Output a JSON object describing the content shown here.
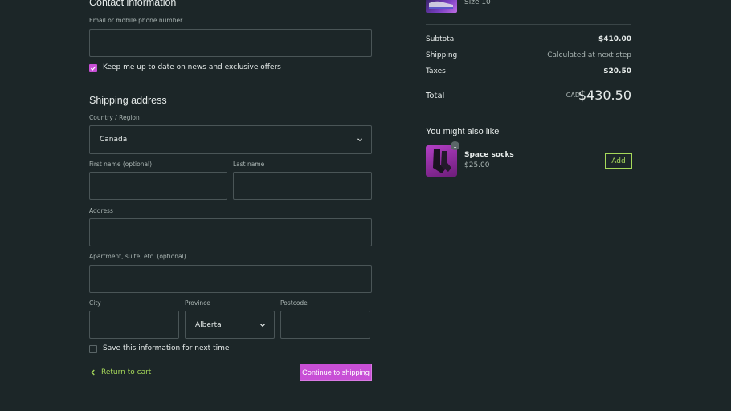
{
  "contact": {
    "heading": "Contact information",
    "email_label": "Email or mobile phone number",
    "email_value": "",
    "newsletter_label": "Keep me up to date on news and exclusive offers",
    "newsletter_checked": true
  },
  "shipping": {
    "heading": "Shipping address",
    "country_label": "Country / Region",
    "country_value": "Canada",
    "first_name_label": "First name (optional)",
    "last_name_label": "Last name",
    "address_label": "Address",
    "apartment_label": "Apartment, suite, etc. (optional)",
    "city_label": "City",
    "province_label": "Province",
    "province_value": "Alberta",
    "postcode_label": "Postcode",
    "save_label": "Save this information for next time",
    "save_checked": false,
    "return_label": "Return to cart",
    "continue_label": "Continue to shipping"
  },
  "summary": {
    "item_variant": "Size 10",
    "subtotal_label": "Subtotal",
    "subtotal_value": "$410.00",
    "shipping_label": "Shipping",
    "shipping_value": "Calculated at next step",
    "taxes_label": "Taxes",
    "taxes_value": "$20.50",
    "total_label": "Total",
    "currency": "CAD",
    "total_value": "$430.50"
  },
  "upsell": {
    "heading": "You might also like",
    "item_name": "Space socks",
    "item_price": "$25.00",
    "item_qty": "1",
    "add_label": "Add"
  },
  "colors": {
    "background": "#1c2628",
    "accent_purple": "#c84fd6",
    "accent_green": "#a6d85a",
    "border": "#4a5557"
  }
}
